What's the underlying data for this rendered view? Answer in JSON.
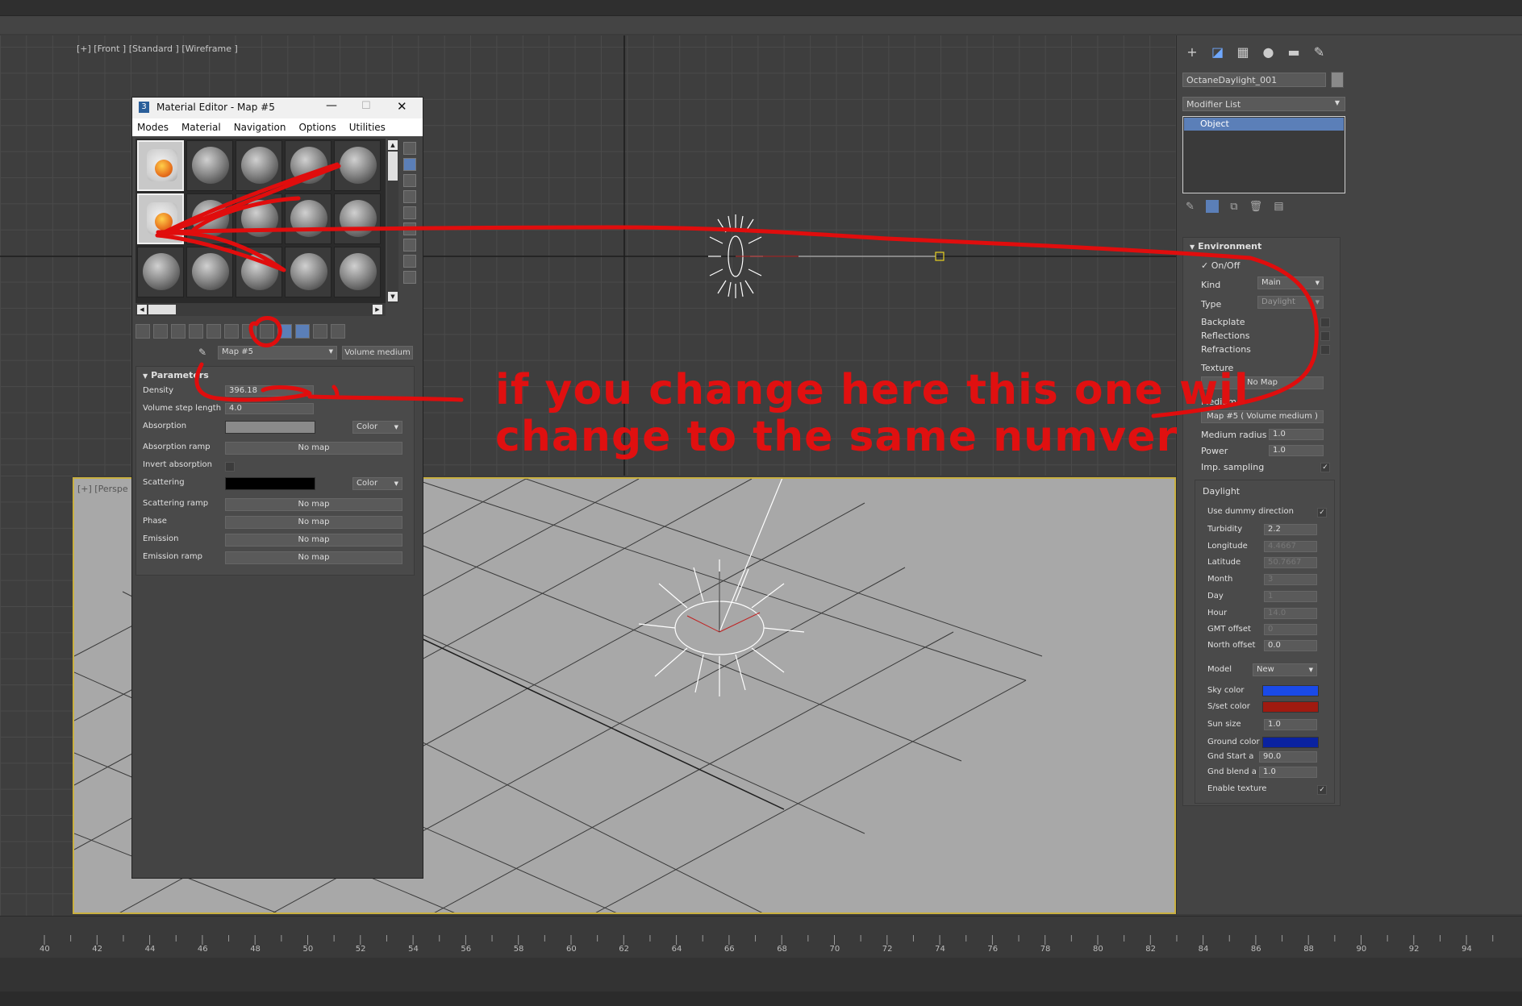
{
  "front_viewport": {
    "label": "[+] [Front ] [Standard ] [Wireframe ]"
  },
  "persp_viewport": {
    "label": "[+] [Perspe"
  },
  "command_panel": {
    "object_name": "OctaneDaylight_001",
    "modifier_list": "Modifier List",
    "stack_item": "Object",
    "environment": {
      "title": "Environment",
      "onoff_label": "On/Off",
      "kind_label": "Kind",
      "kind_value": "Main",
      "type_label": "Type",
      "type_value": "Daylight",
      "backplate_label": "Backplate",
      "reflections_label": "Reflections",
      "refractions_label": "Refractions",
      "texture_label": "Texture",
      "texture_button": "No Map",
      "medium_label": "Medium",
      "medium_button": "Map #5  ( Volume medium )",
      "medium_radius_label": "Medium radius",
      "medium_radius_value": "1.0",
      "power_label": "Power",
      "power_value": "1.0",
      "imp_sampling_label": "Imp. sampling"
    },
    "daylight": {
      "title": "Daylight",
      "use_dummy_label": "Use dummy direction",
      "turbidity_label": "Turbidity",
      "turbidity_value": "2.2",
      "longitude_label": "Longitude",
      "longitude_value": "4.4667",
      "latitude_label": "Latitude",
      "latitude_value": "50.7667",
      "month_label": "Month",
      "month_value": "3",
      "day_label": "Day",
      "day_value": "1",
      "hour_label": "Hour",
      "hour_value": "14.0",
      "gmt_label": "GMT offset",
      "gmt_value": "0",
      "north_label": "North offset",
      "north_value": "0.0",
      "model_label": "Model",
      "model_value": "New",
      "sky_color_label": "Sky color",
      "sky_color": "#1a4ae8",
      "sunset_color_label": "S/set color",
      "sunset_color": "#a01a10",
      "sun_size_label": "Sun size",
      "sun_size_value": "1.0",
      "ground_color_label": "Ground color",
      "ground_color": "#0a22a0",
      "gnd_start_label": "Gnd Start a",
      "gnd_start_value": "90.0",
      "gnd_blend_label": "Gnd blend a",
      "gnd_blend_value": "1.0",
      "enable_texture_label": "Enable texture"
    }
  },
  "timeline": {
    "ticks": [
      "40",
      "42",
      "44",
      "46",
      "48",
      "50",
      "52",
      "54",
      "56",
      "58",
      "60",
      "62",
      "64",
      "66",
      "68",
      "70",
      "72",
      "74",
      "76",
      "78",
      "80",
      "82",
      "84",
      "86",
      "88",
      "90",
      "92",
      "94"
    ]
  },
  "material_editor": {
    "title": "Material Editor - Map #5",
    "menu": [
      "Modes",
      "Material",
      "Navigation",
      "Options",
      "Utilities"
    ],
    "map_name": "Map #5",
    "map_type": "Volume medium",
    "params_title": "Parameters",
    "density_label": "Density",
    "density_value": "396.18",
    "step_label": "Volume step length",
    "step_value": "4.0",
    "absorption_label": "Absorption",
    "absorption_type": "Color",
    "absorption_ramp_label": "Absorption ramp",
    "absorption_ramp_btn": "No map",
    "invert_label": "Invert absorption",
    "scattering_label": "Scattering",
    "scattering_type": "Color",
    "scattering_ramp_label": "Scattering ramp",
    "scattering_ramp_btn": "No map",
    "phase_label": "Phase",
    "phase_btn": "No map",
    "emission_label": "Emission",
    "emission_btn": "No map",
    "emission_ramp_label": "Emission ramp",
    "emission_ramp_btn": "No map"
  },
  "annotation": {
    "line1": "if you change here this one wil",
    "line2": "change to the same numver"
  }
}
